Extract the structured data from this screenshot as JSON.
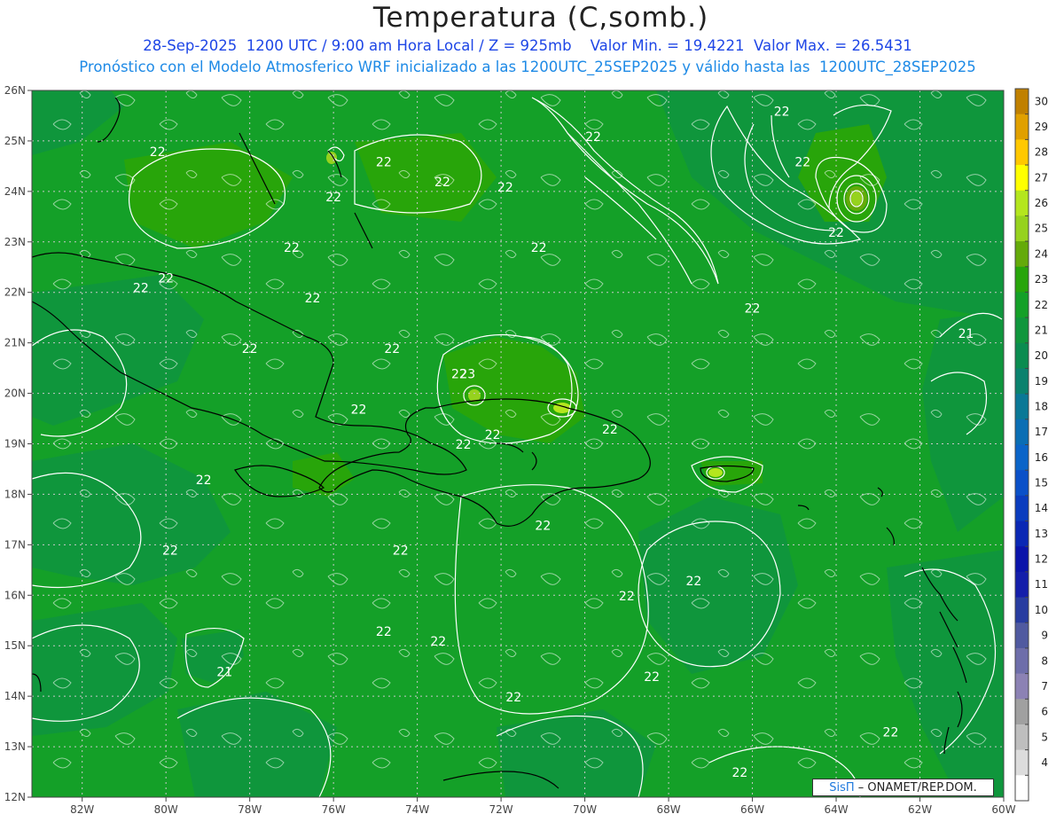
{
  "header": {
    "title": "Temperatura (C,somb.)",
    "line1": "28-Sep-2025  1200 UTC / 9:00 am Hora Local / Z = 925mb    Valor Min. = 19.4221  Valor Max. = 26.5431",
    "line2": "Pronóstico con el Modelo Atmosferico WRF inicializado a las 1200UTC_25SEP2025 y válido hasta las  1200UTC_28SEP2025"
  },
  "map": {
    "lon_labels": [
      "82W",
      "80W",
      "78W",
      "76W",
      "74W",
      "72W",
      "70W",
      "68W",
      "66W",
      "64W",
      "62W",
      "60W"
    ],
    "lat_labels": [
      "26N",
      "25N",
      "24N",
      "23N",
      "22N",
      "21N",
      "20N",
      "19N",
      "18N",
      "17N",
      "16N",
      "15N",
      "14N",
      "13N",
      "12N"
    ],
    "lon_range": [
      -83.2,
      -60
    ],
    "lat_range": [
      12,
      26
    ],
    "grid": true,
    "contour_labels": [
      {
        "text": "22",
        "lon": -80.2,
        "lat": 24.7
      },
      {
        "text": "22",
        "lon": -71.9,
        "lat": 24.0
      },
      {
        "text": "22",
        "lon": -74.8,
        "lat": 24.5
      },
      {
        "text": "22",
        "lon": -73.4,
        "lat": 24.1
      },
      {
        "text": "22",
        "lon": -76.0,
        "lat": 23.8
      },
      {
        "text": "22",
        "lon": -69.8,
        "lat": 25.0
      },
      {
        "text": "22",
        "lon": -65.3,
        "lat": 25.5
      },
      {
        "text": "22",
        "lon": -64.8,
        "lat": 24.5
      },
      {
        "text": "22",
        "lon": -64.0,
        "lat": 23.1
      },
      {
        "text": "22",
        "lon": -77.0,
        "lat": 22.8
      },
      {
        "text": "22",
        "lon": -71.1,
        "lat": 22.8
      },
      {
        "text": "22",
        "lon": -80.0,
        "lat": 22.2
      },
      {
        "text": "22",
        "lon": -80.6,
        "lat": 22.0
      },
      {
        "text": "22",
        "lon": -76.5,
        "lat": 21.8
      },
      {
        "text": "22",
        "lon": -66.0,
        "lat": 21.6
      },
      {
        "text": "22",
        "lon": -78.0,
        "lat": 20.8
      },
      {
        "text": "22",
        "lon": -74.6,
        "lat": 20.8
      },
      {
        "text": "22",
        "lon": -73.0,
        "lat": 20.3
      },
      {
        "text": "22",
        "lon": -75.4,
        "lat": 19.6
      },
      {
        "text": "22",
        "lon": -69.4,
        "lat": 19.2
      },
      {
        "text": "22",
        "lon": -72.2,
        "lat": 19.1
      },
      {
        "text": "22",
        "lon": -72.9,
        "lat": 18.9
      },
      {
        "text": "22",
        "lon": -79.1,
        "lat": 18.2
      },
      {
        "text": "22",
        "lon": -71.0,
        "lat": 17.3
      },
      {
        "text": "22",
        "lon": -79.9,
        "lat": 16.8
      },
      {
        "text": "22",
        "lon": -74.4,
        "lat": 16.8
      },
      {
        "text": "22",
        "lon": -67.4,
        "lat": 16.2
      },
      {
        "text": "22",
        "lon": -69.0,
        "lat": 15.9
      },
      {
        "text": "22",
        "lon": -74.8,
        "lat": 15.2
      },
      {
        "text": "22",
        "lon": -73.5,
        "lat": 15.0
      },
      {
        "text": "22",
        "lon": -68.4,
        "lat": 14.3
      },
      {
        "text": "22",
        "lon": -71.7,
        "lat": 13.9
      },
      {
        "text": "22",
        "lon": -62.7,
        "lat": 13.2
      },
      {
        "text": "22",
        "lon": -66.3,
        "lat": 12.4
      },
      {
        "text": "21",
        "lon": -60.9,
        "lat": 21.1
      },
      {
        "text": "21",
        "lon": -78.6,
        "lat": 14.4
      },
      {
        "text": "23",
        "lon": -72.8,
        "lat": 20.3
      }
    ]
  },
  "colorbar": {
    "labels": [
      "30",
      "29",
      "28",
      "27",
      "26",
      "25",
      "24",
      "23",
      "22",
      "21",
      "20",
      "19",
      "18",
      "17",
      "16",
      "15",
      "14",
      "13",
      "12",
      "11",
      "10",
      "9",
      "8",
      "7",
      "6",
      "5",
      "4"
    ],
    "colors": [
      "#c08000",
      "#e0a000",
      "#ffc800",
      "#ffff00",
      "#b4e61e",
      "#96d21e",
      "#64aa0a",
      "#28a50a",
      "#14a028",
      "#0f963c",
      "#0a8c50",
      "#0a826e",
      "#0a7896",
      "#0a6eb4",
      "#0a64c8",
      "#0a50c8",
      "#0a3cbe",
      "#0a28b4",
      "#0a14aa",
      "#141eaa",
      "#283ca0",
      "#505aa0",
      "#6e6eaa",
      "#8c82b4",
      "#a0a0a0",
      "#bebebe",
      "#dcdcdc",
      "#ffffff"
    ]
  },
  "credit": {
    "logo": "SisΠ",
    "text": "– ONAMET/REP.DOM."
  }
}
